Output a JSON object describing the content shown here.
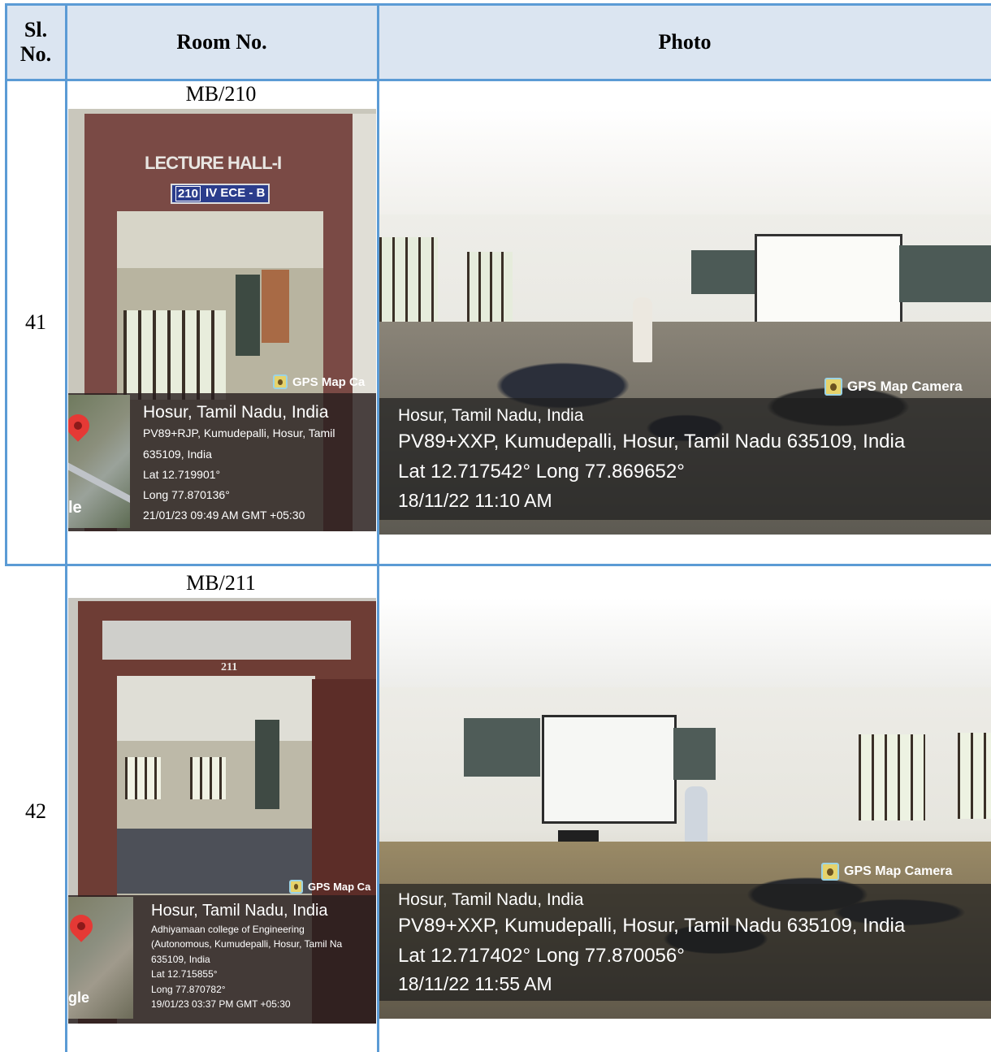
{
  "table": {
    "headers": {
      "sl_no": "Sl.\nNo.",
      "room_no": "Room No.",
      "photo": "Photo"
    },
    "rows": [
      {
        "sl_no": "41",
        "room_no": "MB/210",
        "door_photo": {
          "sign_title": "LECTURE HALL-I",
          "sign_plate_num": "210",
          "sign_plate_text": "IV ECE - B",
          "gps_badge": "GPS Map Ca",
          "title": "Hosur, Tamil Nadu, India",
          "lines": [
            "PV89+RJP, Kumudepalli, Hosur, Tamil",
            "635109, India",
            "Lat 12.719901°",
            "Long 77.870136°",
            "21/01/23 09:49 AM GMT +05:30"
          ],
          "map_text": "le"
        },
        "class_photo": {
          "gps_badge": "GPS Map Camera",
          "title": "Hosur, Tamil Nadu, India",
          "address": "PV89+XXP, Kumudepalli, Hosur, Tamil Nadu 635109, India",
          "coords": "Lat 12.717542° Long 77.869652°",
          "datetime": "18/11/22 11:10 AM"
        }
      },
      {
        "sl_no": "42",
        "room_no": "MB/211",
        "door_photo": {
          "sign_plate_num": "211",
          "gps_badge": "GPS Map Ca",
          "title": "Hosur, Tamil Nadu, India",
          "lines": [
            "Adhiyamaan college of Engineering",
            "(Autonomous, Kumudepalli, Hosur, Tamil Na",
            "635109, India",
            "Lat 12.715855°",
            "Long 77.870782°",
            "19/01/23 03:37 PM GMT +05:30"
          ],
          "map_text": "gle"
        },
        "class_photo": {
          "gps_badge": "GPS Map Camera",
          "title": "Hosur, Tamil Nadu, India",
          "address": "PV89+XXP, Kumudepalli, Hosur, Tamil Nadu 635109, India",
          "coords": "Lat 12.717402° Long 77.870056°",
          "datetime": "18/11/22 11:55 AM"
        }
      }
    ]
  },
  "colors": {
    "grid": "#5b9bd5",
    "header_bg": "#dbe5f1"
  }
}
